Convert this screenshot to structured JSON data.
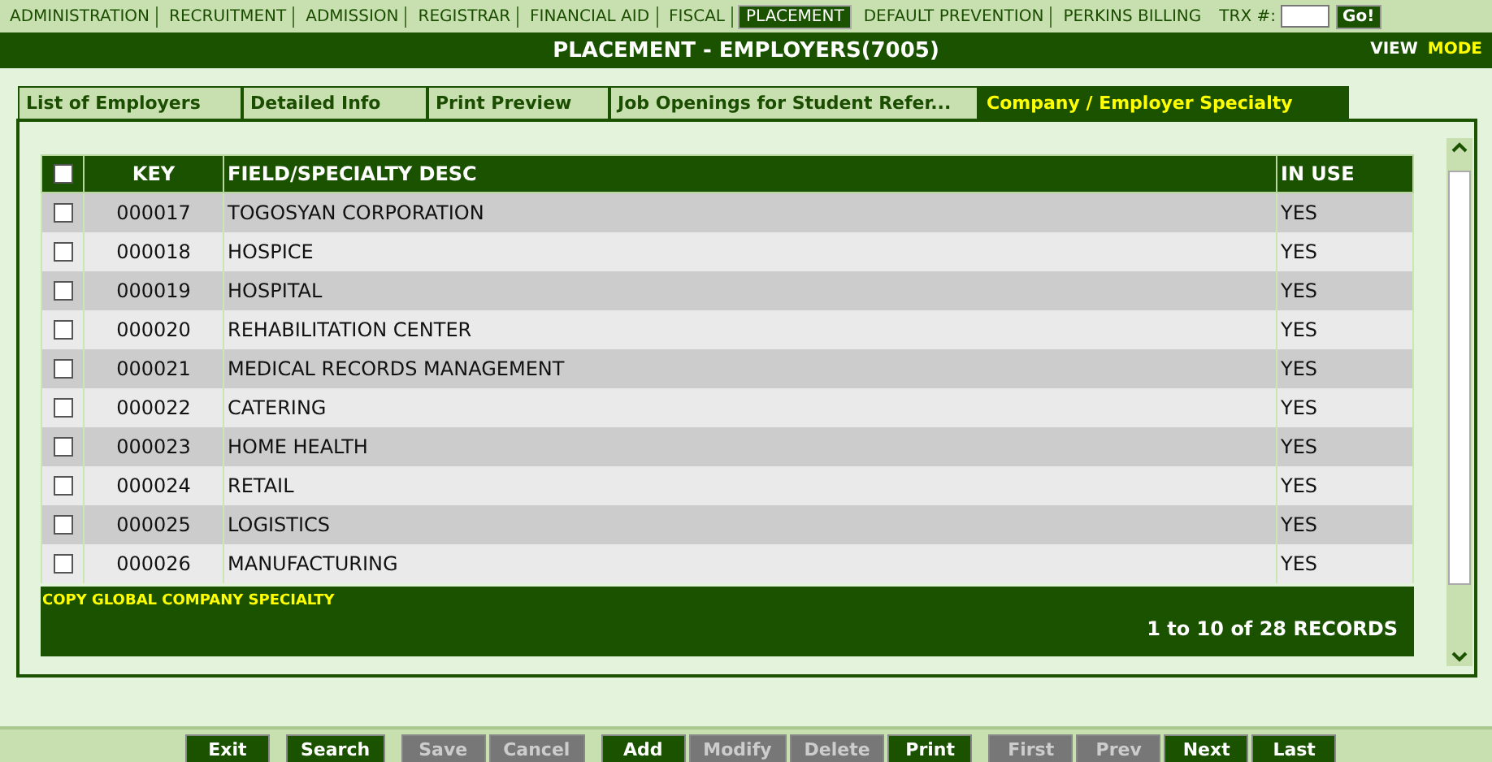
{
  "menu": [
    {
      "label": "ADMINISTRATION",
      "selected": false
    },
    {
      "label": "RECRUITMENT",
      "selected": false
    },
    {
      "label": "ADMISSION",
      "selected": false
    },
    {
      "label": "REGISTRAR",
      "selected": false
    },
    {
      "label": "FINANCIAL AID",
      "selected": false
    },
    {
      "label": "FISCAL",
      "selected": false
    },
    {
      "label": "PLACEMENT",
      "selected": true
    },
    {
      "label": "DEFAULT PREVENTION",
      "selected": false
    },
    {
      "label": "PERKINS BILLING",
      "selected": false
    }
  ],
  "trx": {
    "label": "TRX #:",
    "button": "Go!"
  },
  "title": "PLACEMENT - EMPLOYERS(7005)",
  "mode": {
    "view": "VIEW",
    "mode": "MODE"
  },
  "tabs": [
    {
      "label": "List of Employers",
      "selected": false
    },
    {
      "label": "Detailed Info",
      "selected": false
    },
    {
      "label": "Print Preview",
      "selected": false
    },
    {
      "label": "Job Openings for Student Refer...",
      "selected": false
    },
    {
      "label": "Company / Employer Specialty",
      "selected": true
    }
  ],
  "table": {
    "select_all_checked": false,
    "columns": [
      "KEY",
      "FIELD/SPECIALTY DESC",
      "IN USE"
    ],
    "rows": [
      {
        "checked": false,
        "key": "000017",
        "desc": "TOGOSYAN CORPORATION",
        "in_use": "YES"
      },
      {
        "checked": false,
        "key": "000018",
        "desc": "HOSPICE",
        "in_use": "YES"
      },
      {
        "checked": false,
        "key": "000019",
        "desc": "HOSPITAL",
        "in_use": "YES"
      },
      {
        "checked": false,
        "key": "000020",
        "desc": "REHABILITATION CENTER",
        "in_use": "YES"
      },
      {
        "checked": false,
        "key": "000021",
        "desc": "MEDICAL RECORDS MANAGEMENT",
        "in_use": "YES"
      },
      {
        "checked": false,
        "key": "000022",
        "desc": "CATERING",
        "in_use": "YES"
      },
      {
        "checked": false,
        "key": "000023",
        "desc": "HOME HEALTH",
        "in_use": "YES"
      },
      {
        "checked": false,
        "key": "000024",
        "desc": "RETAIL",
        "in_use": "YES"
      },
      {
        "checked": false,
        "key": "000025",
        "desc": "LOGISTICS",
        "in_use": "YES"
      },
      {
        "checked": false,
        "key": "000026",
        "desc": "MANUFACTURING",
        "in_use": "YES"
      }
    ],
    "footer_link": "COPY GLOBAL COMPANY SPECIALTY",
    "record_count": "1 to 10 of 28 RECORDS"
  },
  "buttons": [
    [
      {
        "label": "Exit",
        "disabled": false
      }
    ],
    [
      {
        "label": "Search",
        "disabled": false
      }
    ],
    [
      {
        "label": "Save",
        "disabled": true
      },
      {
        "label": "Cancel",
        "disabled": true
      }
    ],
    [
      {
        "label": "Add",
        "disabled": false
      },
      {
        "label": "Modify",
        "disabled": true
      },
      {
        "label": "Delete",
        "disabled": true
      },
      {
        "label": "Print",
        "disabled": false
      }
    ],
    [
      {
        "label": "First",
        "disabled": true
      },
      {
        "label": "Prev",
        "disabled": true
      },
      {
        "label": "Next",
        "disabled": false
      },
      {
        "label": "Last",
        "disabled": false
      }
    ]
  ]
}
